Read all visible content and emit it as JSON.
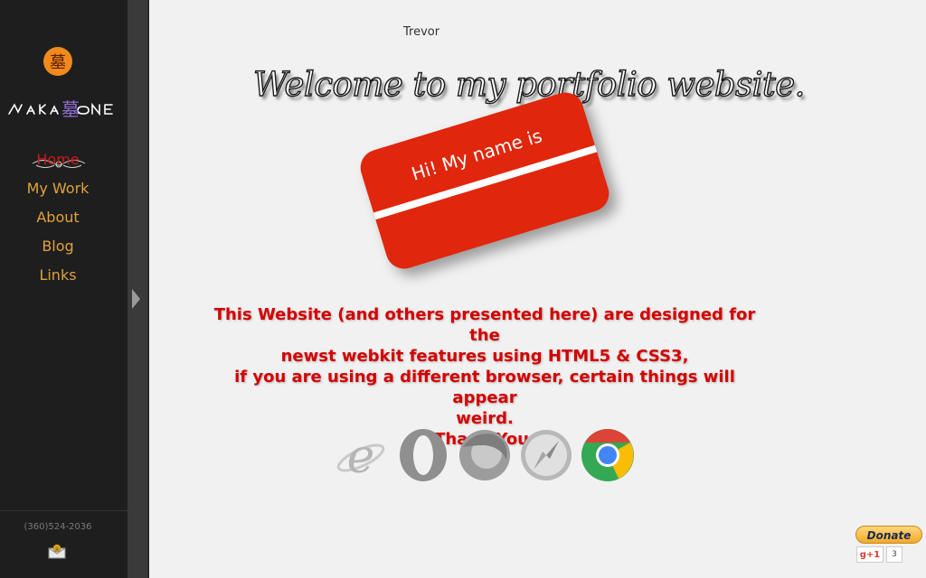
{
  "sidebar": {
    "seal_glyph": "墓",
    "logo_text": "NAKAONE",
    "nav": [
      {
        "label": "Home",
        "active": true
      },
      {
        "label": "My Work",
        "active": false
      },
      {
        "label": "About",
        "active": false
      },
      {
        "label": "Blog",
        "active": false
      },
      {
        "label": "Links",
        "active": false
      }
    ],
    "phone": "(360)524-2036"
  },
  "main": {
    "user_name": "Trevor",
    "welcome": "Welcome to my portfolio website.",
    "name_card_text": "Hi! My name is",
    "notice": [
      "This Website (and others presented here) are designed for the",
      "newst webkit features using HTML5 & CSS3,",
      "if you are using a different browser, certain things will appear",
      "weird.",
      "Thank You."
    ],
    "browser_icons": [
      "internet-explorer-icon",
      "opera-icon",
      "firefox-icon",
      "safari-icon",
      "chrome-icon"
    ]
  },
  "widgets": {
    "donate_label": "Donate",
    "gplus_label": "g+1",
    "gplus_count": "3"
  },
  "colors": {
    "sidebar_bg": "#1e1e1e",
    "nav_link": "#e0a23c",
    "nav_active": "#cc1a1a",
    "card_red": "#e0260c",
    "notice_red": "#d40000"
  }
}
